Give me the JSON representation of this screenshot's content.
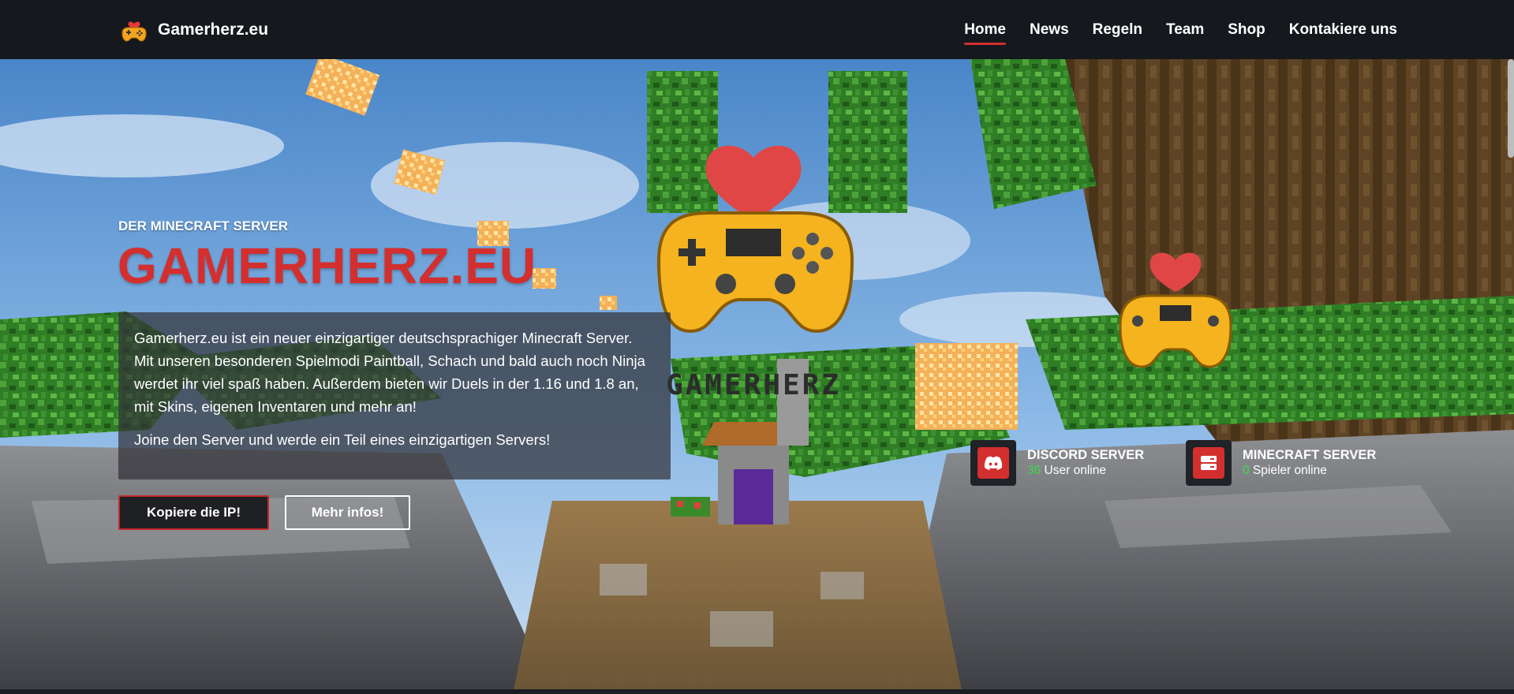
{
  "brand": {
    "name": "Gamerherz.eu",
    "logo_icon": "gamepad-heart-icon"
  },
  "nav": {
    "items": [
      {
        "label": "Home",
        "active": true
      },
      {
        "label": "News",
        "active": false
      },
      {
        "label": "Regeln",
        "active": false
      },
      {
        "label": "Team",
        "active": false
      },
      {
        "label": "Shop",
        "active": false
      },
      {
        "label": "Kontakiere uns",
        "active": false
      }
    ]
  },
  "hero": {
    "eyebrow": "Der Minecraft Server",
    "title": "GAMERHERZ.EU",
    "description": "Gamerherz.eu ist ein neuer einzigartiger deutschsprachiger Minecraft Server. Mit unseren besonderen Spielmodi Paintball, Schach und bald auch noch Ninja werdet ihr viel spaß haben. Außerdem bieten wir Duels in der 1.16 und 1.8 an, mit Skins, eigenen Inventaren und mehr an!",
    "cta_text": "Joine den Server und werde ein Teil eines einzigartigen Servers!",
    "primary_button": "Kopiere die IP!",
    "secondary_button": "Mehr infos!",
    "scene_logo_text": "GAMERHERZ"
  },
  "stats": {
    "discord": {
      "title": "Discord Server",
      "count": "36",
      "suffix": " User online",
      "icon": "discord-icon"
    },
    "minecraft": {
      "title": "Minecraft Server",
      "count": "0",
      "suffix": " Spieler online",
      "icon": "server-icon"
    }
  },
  "colors": {
    "accent": "#d32f2f",
    "nav_bg": "#15181d",
    "online_green": "#3ddc4a",
    "sky": "#6fa7dc"
  }
}
